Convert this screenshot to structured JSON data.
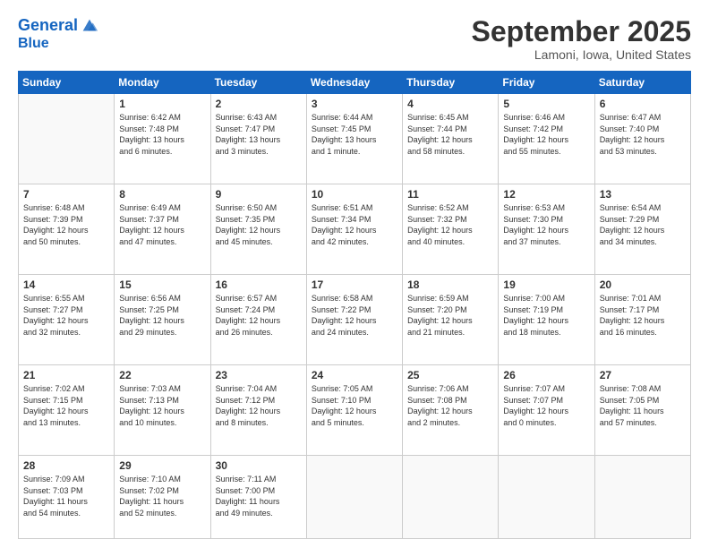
{
  "logo": {
    "line1": "General",
    "line2": "Blue"
  },
  "title": "September 2025",
  "location": "Lamoni, Iowa, United States",
  "weekdays": [
    "Sunday",
    "Monday",
    "Tuesday",
    "Wednesday",
    "Thursday",
    "Friday",
    "Saturday"
  ],
  "weeks": [
    [
      {
        "day": "",
        "info": ""
      },
      {
        "day": "1",
        "info": "Sunrise: 6:42 AM\nSunset: 7:48 PM\nDaylight: 13 hours\nand 6 minutes."
      },
      {
        "day": "2",
        "info": "Sunrise: 6:43 AM\nSunset: 7:47 PM\nDaylight: 13 hours\nand 3 minutes."
      },
      {
        "day": "3",
        "info": "Sunrise: 6:44 AM\nSunset: 7:45 PM\nDaylight: 13 hours\nand 1 minute."
      },
      {
        "day": "4",
        "info": "Sunrise: 6:45 AM\nSunset: 7:44 PM\nDaylight: 12 hours\nand 58 minutes."
      },
      {
        "day": "5",
        "info": "Sunrise: 6:46 AM\nSunset: 7:42 PM\nDaylight: 12 hours\nand 55 minutes."
      },
      {
        "day": "6",
        "info": "Sunrise: 6:47 AM\nSunset: 7:40 PM\nDaylight: 12 hours\nand 53 minutes."
      }
    ],
    [
      {
        "day": "7",
        "info": "Sunrise: 6:48 AM\nSunset: 7:39 PM\nDaylight: 12 hours\nand 50 minutes."
      },
      {
        "day": "8",
        "info": "Sunrise: 6:49 AM\nSunset: 7:37 PM\nDaylight: 12 hours\nand 47 minutes."
      },
      {
        "day": "9",
        "info": "Sunrise: 6:50 AM\nSunset: 7:35 PM\nDaylight: 12 hours\nand 45 minutes."
      },
      {
        "day": "10",
        "info": "Sunrise: 6:51 AM\nSunset: 7:34 PM\nDaylight: 12 hours\nand 42 minutes."
      },
      {
        "day": "11",
        "info": "Sunrise: 6:52 AM\nSunset: 7:32 PM\nDaylight: 12 hours\nand 40 minutes."
      },
      {
        "day": "12",
        "info": "Sunrise: 6:53 AM\nSunset: 7:30 PM\nDaylight: 12 hours\nand 37 minutes."
      },
      {
        "day": "13",
        "info": "Sunrise: 6:54 AM\nSunset: 7:29 PM\nDaylight: 12 hours\nand 34 minutes."
      }
    ],
    [
      {
        "day": "14",
        "info": "Sunrise: 6:55 AM\nSunset: 7:27 PM\nDaylight: 12 hours\nand 32 minutes."
      },
      {
        "day": "15",
        "info": "Sunrise: 6:56 AM\nSunset: 7:25 PM\nDaylight: 12 hours\nand 29 minutes."
      },
      {
        "day": "16",
        "info": "Sunrise: 6:57 AM\nSunset: 7:24 PM\nDaylight: 12 hours\nand 26 minutes."
      },
      {
        "day": "17",
        "info": "Sunrise: 6:58 AM\nSunset: 7:22 PM\nDaylight: 12 hours\nand 24 minutes."
      },
      {
        "day": "18",
        "info": "Sunrise: 6:59 AM\nSunset: 7:20 PM\nDaylight: 12 hours\nand 21 minutes."
      },
      {
        "day": "19",
        "info": "Sunrise: 7:00 AM\nSunset: 7:19 PM\nDaylight: 12 hours\nand 18 minutes."
      },
      {
        "day": "20",
        "info": "Sunrise: 7:01 AM\nSunset: 7:17 PM\nDaylight: 12 hours\nand 16 minutes."
      }
    ],
    [
      {
        "day": "21",
        "info": "Sunrise: 7:02 AM\nSunset: 7:15 PM\nDaylight: 12 hours\nand 13 minutes."
      },
      {
        "day": "22",
        "info": "Sunrise: 7:03 AM\nSunset: 7:13 PM\nDaylight: 12 hours\nand 10 minutes."
      },
      {
        "day": "23",
        "info": "Sunrise: 7:04 AM\nSunset: 7:12 PM\nDaylight: 12 hours\nand 8 minutes."
      },
      {
        "day": "24",
        "info": "Sunrise: 7:05 AM\nSunset: 7:10 PM\nDaylight: 12 hours\nand 5 minutes."
      },
      {
        "day": "25",
        "info": "Sunrise: 7:06 AM\nSunset: 7:08 PM\nDaylight: 12 hours\nand 2 minutes."
      },
      {
        "day": "26",
        "info": "Sunrise: 7:07 AM\nSunset: 7:07 PM\nDaylight: 12 hours\nand 0 minutes."
      },
      {
        "day": "27",
        "info": "Sunrise: 7:08 AM\nSunset: 7:05 PM\nDaylight: 11 hours\nand 57 minutes."
      }
    ],
    [
      {
        "day": "28",
        "info": "Sunrise: 7:09 AM\nSunset: 7:03 PM\nDaylight: 11 hours\nand 54 minutes."
      },
      {
        "day": "29",
        "info": "Sunrise: 7:10 AM\nSunset: 7:02 PM\nDaylight: 11 hours\nand 52 minutes."
      },
      {
        "day": "30",
        "info": "Sunrise: 7:11 AM\nSunset: 7:00 PM\nDaylight: 11 hours\nand 49 minutes."
      },
      {
        "day": "",
        "info": ""
      },
      {
        "day": "",
        "info": ""
      },
      {
        "day": "",
        "info": ""
      },
      {
        "day": "",
        "info": ""
      }
    ]
  ]
}
